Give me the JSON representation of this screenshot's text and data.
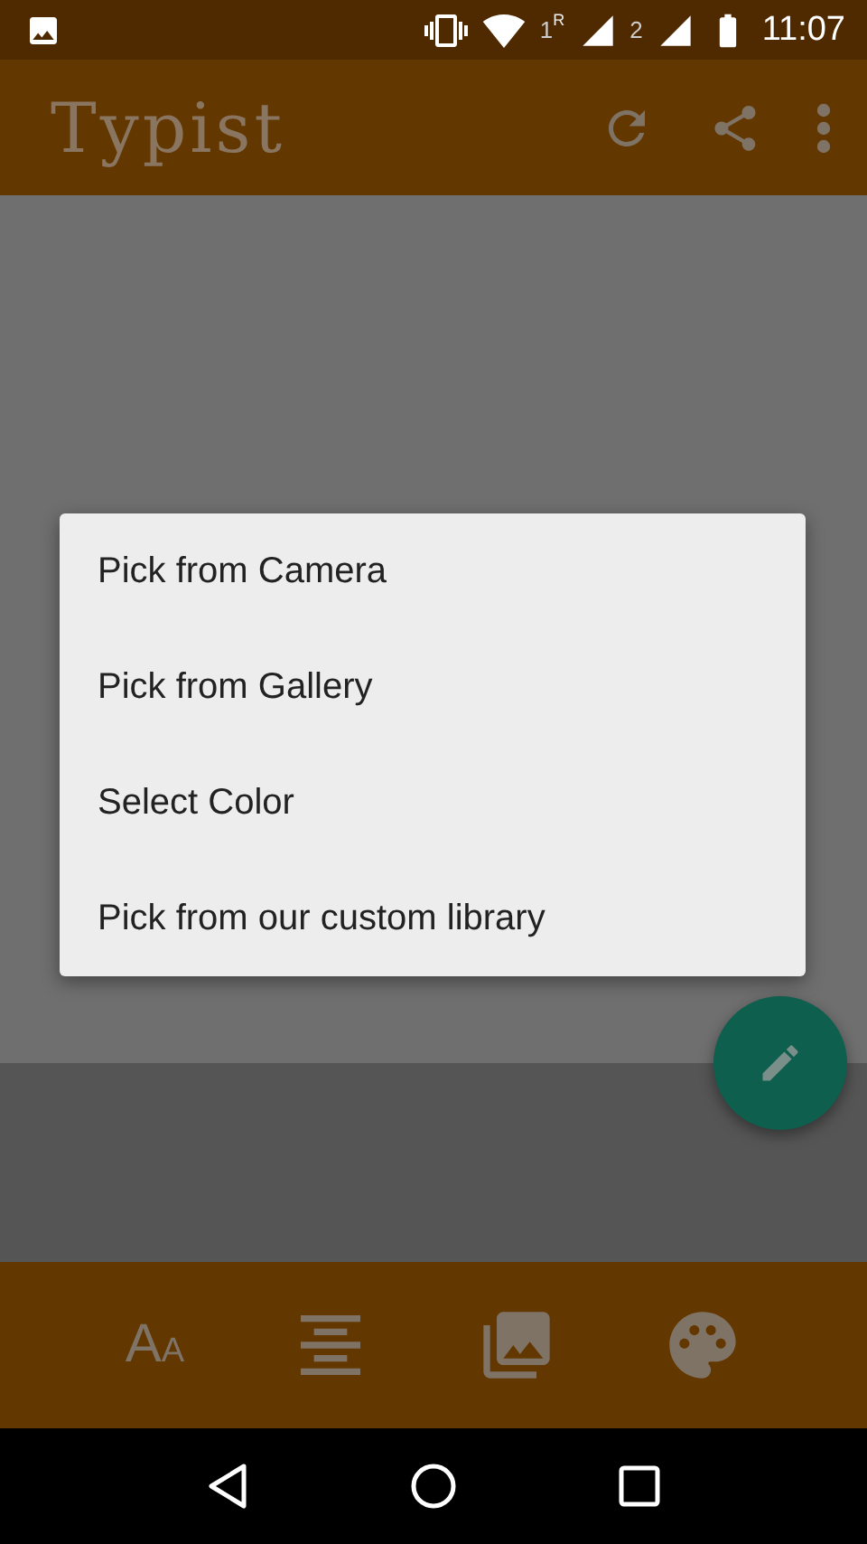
{
  "status_bar": {
    "sim_1": "1",
    "sim_1_roaming": "R",
    "sim_2": "2",
    "time": "11:07"
  },
  "app_bar": {
    "title": "Typist"
  },
  "dialog": {
    "items": [
      {
        "label": "Pick from Camera"
      },
      {
        "label": "Pick from Gallery"
      },
      {
        "label": "Select Color"
      },
      {
        "label": "Pick from our custom library"
      }
    ]
  },
  "toolbar": {
    "text_size": {
      "large": "A",
      "small": "A"
    }
  }
}
